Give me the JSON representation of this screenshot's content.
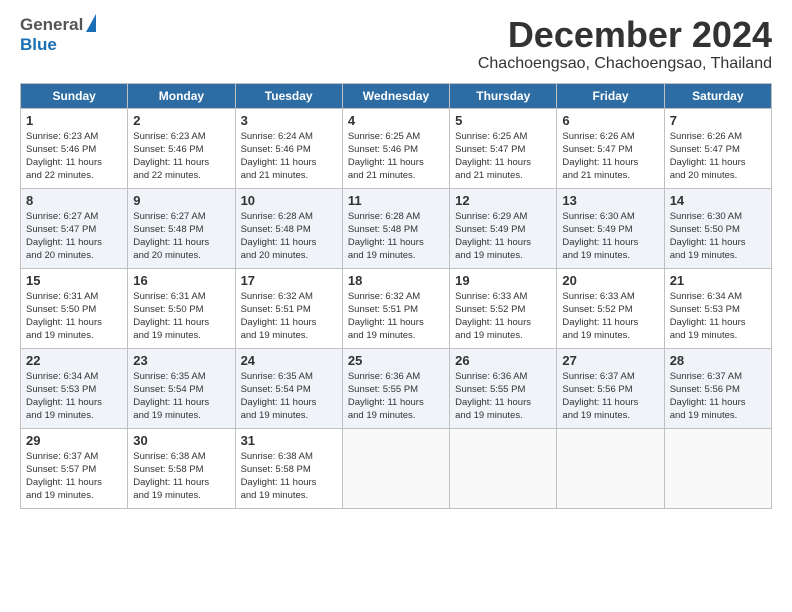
{
  "header": {
    "logo_line1": "General",
    "logo_line2": "Blue",
    "title": "December 2024",
    "location": "Chachoengsao, Chachoengsao, Thailand"
  },
  "calendar": {
    "days_of_week": [
      "Sunday",
      "Monday",
      "Tuesday",
      "Wednesday",
      "Thursday",
      "Friday",
      "Saturday"
    ],
    "weeks": [
      [
        {
          "day": "",
          "info": ""
        },
        {
          "day": "2",
          "info": "Sunrise: 6:23 AM\nSunset: 5:46 PM\nDaylight: 11 hours\nand 22 minutes."
        },
        {
          "day": "3",
          "info": "Sunrise: 6:24 AM\nSunset: 5:46 PM\nDaylight: 11 hours\nand 21 minutes."
        },
        {
          "day": "4",
          "info": "Sunrise: 6:25 AM\nSunset: 5:46 PM\nDaylight: 11 hours\nand 21 minutes."
        },
        {
          "day": "5",
          "info": "Sunrise: 6:25 AM\nSunset: 5:47 PM\nDaylight: 11 hours\nand 21 minutes."
        },
        {
          "day": "6",
          "info": "Sunrise: 6:26 AM\nSunset: 5:47 PM\nDaylight: 11 hours\nand 21 minutes."
        },
        {
          "day": "7",
          "info": "Sunrise: 6:26 AM\nSunset: 5:47 PM\nDaylight: 11 hours\nand 20 minutes."
        }
      ],
      [
        {
          "day": "8",
          "info": "Sunrise: 6:27 AM\nSunset: 5:47 PM\nDaylight: 11 hours\nand 20 minutes."
        },
        {
          "day": "9",
          "info": "Sunrise: 6:27 AM\nSunset: 5:48 PM\nDaylight: 11 hours\nand 20 minutes."
        },
        {
          "day": "10",
          "info": "Sunrise: 6:28 AM\nSunset: 5:48 PM\nDaylight: 11 hours\nand 20 minutes."
        },
        {
          "day": "11",
          "info": "Sunrise: 6:28 AM\nSunset: 5:48 PM\nDaylight: 11 hours\nand 19 minutes."
        },
        {
          "day": "12",
          "info": "Sunrise: 6:29 AM\nSunset: 5:49 PM\nDaylight: 11 hours\nand 19 minutes."
        },
        {
          "day": "13",
          "info": "Sunrise: 6:30 AM\nSunset: 5:49 PM\nDaylight: 11 hours\nand 19 minutes."
        },
        {
          "day": "14",
          "info": "Sunrise: 6:30 AM\nSunset: 5:50 PM\nDaylight: 11 hours\nand 19 minutes."
        }
      ],
      [
        {
          "day": "15",
          "info": "Sunrise: 6:31 AM\nSunset: 5:50 PM\nDaylight: 11 hours\nand 19 minutes."
        },
        {
          "day": "16",
          "info": "Sunrise: 6:31 AM\nSunset: 5:50 PM\nDaylight: 11 hours\nand 19 minutes."
        },
        {
          "day": "17",
          "info": "Sunrise: 6:32 AM\nSunset: 5:51 PM\nDaylight: 11 hours\nand 19 minutes."
        },
        {
          "day": "18",
          "info": "Sunrise: 6:32 AM\nSunset: 5:51 PM\nDaylight: 11 hours\nand 19 minutes."
        },
        {
          "day": "19",
          "info": "Sunrise: 6:33 AM\nSunset: 5:52 PM\nDaylight: 11 hours\nand 19 minutes."
        },
        {
          "day": "20",
          "info": "Sunrise: 6:33 AM\nSunset: 5:52 PM\nDaylight: 11 hours\nand 19 minutes."
        },
        {
          "day": "21",
          "info": "Sunrise: 6:34 AM\nSunset: 5:53 PM\nDaylight: 11 hours\nand 19 minutes."
        }
      ],
      [
        {
          "day": "22",
          "info": "Sunrise: 6:34 AM\nSunset: 5:53 PM\nDaylight: 11 hours\nand 19 minutes."
        },
        {
          "day": "23",
          "info": "Sunrise: 6:35 AM\nSunset: 5:54 PM\nDaylight: 11 hours\nand 19 minutes."
        },
        {
          "day": "24",
          "info": "Sunrise: 6:35 AM\nSunset: 5:54 PM\nDaylight: 11 hours\nand 19 minutes."
        },
        {
          "day": "25",
          "info": "Sunrise: 6:36 AM\nSunset: 5:55 PM\nDaylight: 11 hours\nand 19 minutes."
        },
        {
          "day": "26",
          "info": "Sunrise: 6:36 AM\nSunset: 5:55 PM\nDaylight: 11 hours\nand 19 minutes."
        },
        {
          "day": "27",
          "info": "Sunrise: 6:37 AM\nSunset: 5:56 PM\nDaylight: 11 hours\nand 19 minutes."
        },
        {
          "day": "28",
          "info": "Sunrise: 6:37 AM\nSunset: 5:56 PM\nDaylight: 11 hours\nand 19 minutes."
        }
      ],
      [
        {
          "day": "29",
          "info": "Sunrise: 6:37 AM\nSunset: 5:57 PM\nDaylight: 11 hours\nand 19 minutes."
        },
        {
          "day": "30",
          "info": "Sunrise: 6:38 AM\nSunset: 5:58 PM\nDaylight: 11 hours\nand 19 minutes."
        },
        {
          "day": "31",
          "info": "Sunrise: 6:38 AM\nSunset: 5:58 PM\nDaylight: 11 hours\nand 19 minutes."
        },
        {
          "day": "",
          "info": ""
        },
        {
          "day": "",
          "info": ""
        },
        {
          "day": "",
          "info": ""
        },
        {
          "day": "",
          "info": ""
        }
      ]
    ],
    "week1_sunday": {
      "day": "1",
      "info": "Sunrise: 6:23 AM\nSunset: 5:46 PM\nDaylight: 11 hours\nand 22 minutes."
    }
  }
}
